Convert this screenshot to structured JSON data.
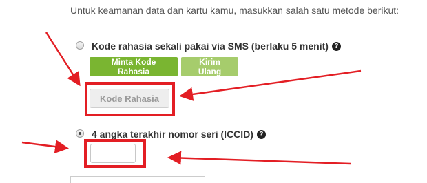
{
  "intro_text": "Untuk keamanan data dan kartu kamu, masukkan salah satu metode berikut:",
  "option_sms": {
    "label": "Kode rahasia sekali pakai via SMS (berlaku 5 menit)",
    "selected": false,
    "help_icon": "question-circle-icon",
    "request_button": "Minta Kode Rahasia",
    "resend_button": "Kirim Ulang",
    "code_button": "Kode Rahasia"
  },
  "option_iccid": {
    "label": "4 angka terakhir nomor seri (ICCID)",
    "selected": true,
    "help_icon": "question-circle-icon",
    "input_value": ""
  },
  "colors": {
    "annotation": "#e31e24",
    "primary_green": "#7ab531",
    "light_green": "#a6cc6c"
  }
}
